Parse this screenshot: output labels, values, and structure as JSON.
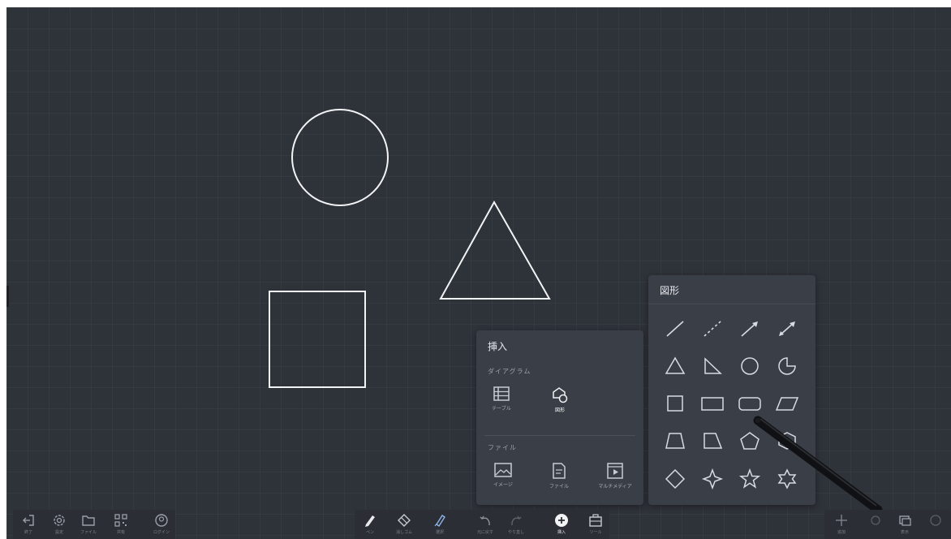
{
  "insert_panel": {
    "title": "挿入",
    "diagram_section": "ダイアグラム",
    "file_section": "ファイル",
    "items": [
      {
        "label": "テーブル",
        "icon": "table-icon"
      },
      {
        "label": "図形",
        "icon": "shapes-icon",
        "active": true
      },
      {
        "label": "イメージ",
        "icon": "image-icon"
      },
      {
        "label": "ファイル",
        "icon": "document-icon"
      },
      {
        "label": "マルチメディア",
        "icon": "media-icon"
      }
    ]
  },
  "shapes_panel": {
    "title": "図形",
    "shapes": [
      "line",
      "dashed-line",
      "arrow",
      "double-arrow",
      "triangle",
      "right-triangle",
      "circle",
      "pie",
      "square",
      "rectangle",
      "rounded-rectangle",
      "parallelogram",
      "trapezoid",
      "right-trapezoid",
      "pentagon",
      "hexagon",
      "diamond",
      "four-point-star",
      "star",
      "six-point-star"
    ]
  },
  "left_toolbar": {
    "items": [
      {
        "icon": "exit-icon",
        "label": "終了"
      },
      {
        "icon": "gear-icon",
        "label": "設定"
      },
      {
        "icon": "folder-icon",
        "label": "ファイル"
      },
      {
        "icon": "qr-code-icon",
        "label": "共有"
      },
      {
        "icon": "account-icon",
        "label": "ログイン"
      }
    ]
  },
  "center_toolbar": {
    "items": [
      {
        "icon": "pen-icon",
        "label": "ペン"
      },
      {
        "icon": "eraser-icon",
        "label": "消しゴム"
      },
      {
        "icon": "select-icon",
        "label": "選択"
      },
      {
        "icon": "undo-icon",
        "label": "元に戻す"
      },
      {
        "icon": "redo-icon",
        "label": "やり直し"
      },
      {
        "icon": "insert-plus-icon",
        "label": "挿入"
      },
      {
        "icon": "toolbox-icon",
        "label": "ツール"
      }
    ]
  },
  "right_toolbar": {
    "items": [
      {
        "icon": "add-page-icon",
        "label": "追加"
      },
      {
        "icon": "page-icon",
        "label": ""
      },
      {
        "icon": "multi-window-icon",
        "label": "表示"
      },
      {
        "icon": "more-icon",
        "label": ""
      }
    ]
  },
  "colors": {
    "board": "#2e3239",
    "panel": "#3a3e46",
    "stroke": "#ffffff",
    "icon": "#c8ccd2"
  }
}
